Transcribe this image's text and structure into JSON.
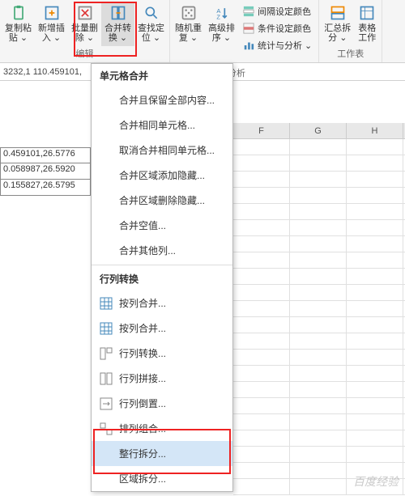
{
  "ribbon": {
    "groups": {
      "edit": {
        "label": "编辑",
        "buttons": [
          {
            "label": "复制粘\n贴 ⌄"
          },
          {
            "label": "新增插\n入 ⌄"
          },
          {
            "label": "批量删\n除 ⌄"
          },
          {
            "label": "合并转\n换 ⌄"
          },
          {
            "label": "查找定\n位 ⌄"
          }
        ]
      },
      "data": {
        "buttons": [
          {
            "label": "随机重\n复 ⌄"
          },
          {
            "label": "高级排\n序 ⌄"
          }
        ],
        "mini": [
          {
            "label": "间隔设定颜色"
          },
          {
            "label": "条件设定颜色"
          },
          {
            "label": "统计与分析 ⌄"
          }
        ]
      },
      "tools": {
        "label": "工作表",
        "buttons": [
          {
            "label": "汇总拆\n分 ⌄"
          },
          {
            "label": "表格\n工作"
          }
        ]
      }
    }
  },
  "analysis_label": "据分析",
  "formula_bar": {
    "content": "3232,1 110.459101,"
  },
  "columns": [
    "F",
    "G",
    "H"
  ],
  "data_rows": [
    "0.459101,26.5776",
    "0.058987,26.5920",
    "0.155827,26.5795"
  ],
  "menu": {
    "sections": [
      {
        "title": "单元格合并",
        "items": [
          {
            "label": "合并且保留全部内容..."
          },
          {
            "label": "合并相同单元格..."
          },
          {
            "label": "取消合并相同单元格..."
          },
          {
            "label": "合并区域添加隐藏..."
          },
          {
            "label": "合并区域删除隐藏..."
          },
          {
            "label": "合并空值..."
          },
          {
            "label": "合并其他列..."
          }
        ]
      },
      {
        "title": "行列转换",
        "items": [
          {
            "label": "按列合并...",
            "icon": true
          },
          {
            "label": "按列合并...",
            "icon": true
          },
          {
            "label": "行列转换...",
            "icon": true
          },
          {
            "label": "行列拼接...",
            "icon": true
          },
          {
            "label": "行列倒置...",
            "icon": true
          },
          {
            "label": "排列组合...",
            "icon": true
          },
          {
            "label": "整行拆分...",
            "icon": true,
            "highlight": true
          },
          {
            "label": "区域拆分...",
            "icon": true
          }
        ]
      }
    ]
  },
  "watermark": "百度经验"
}
